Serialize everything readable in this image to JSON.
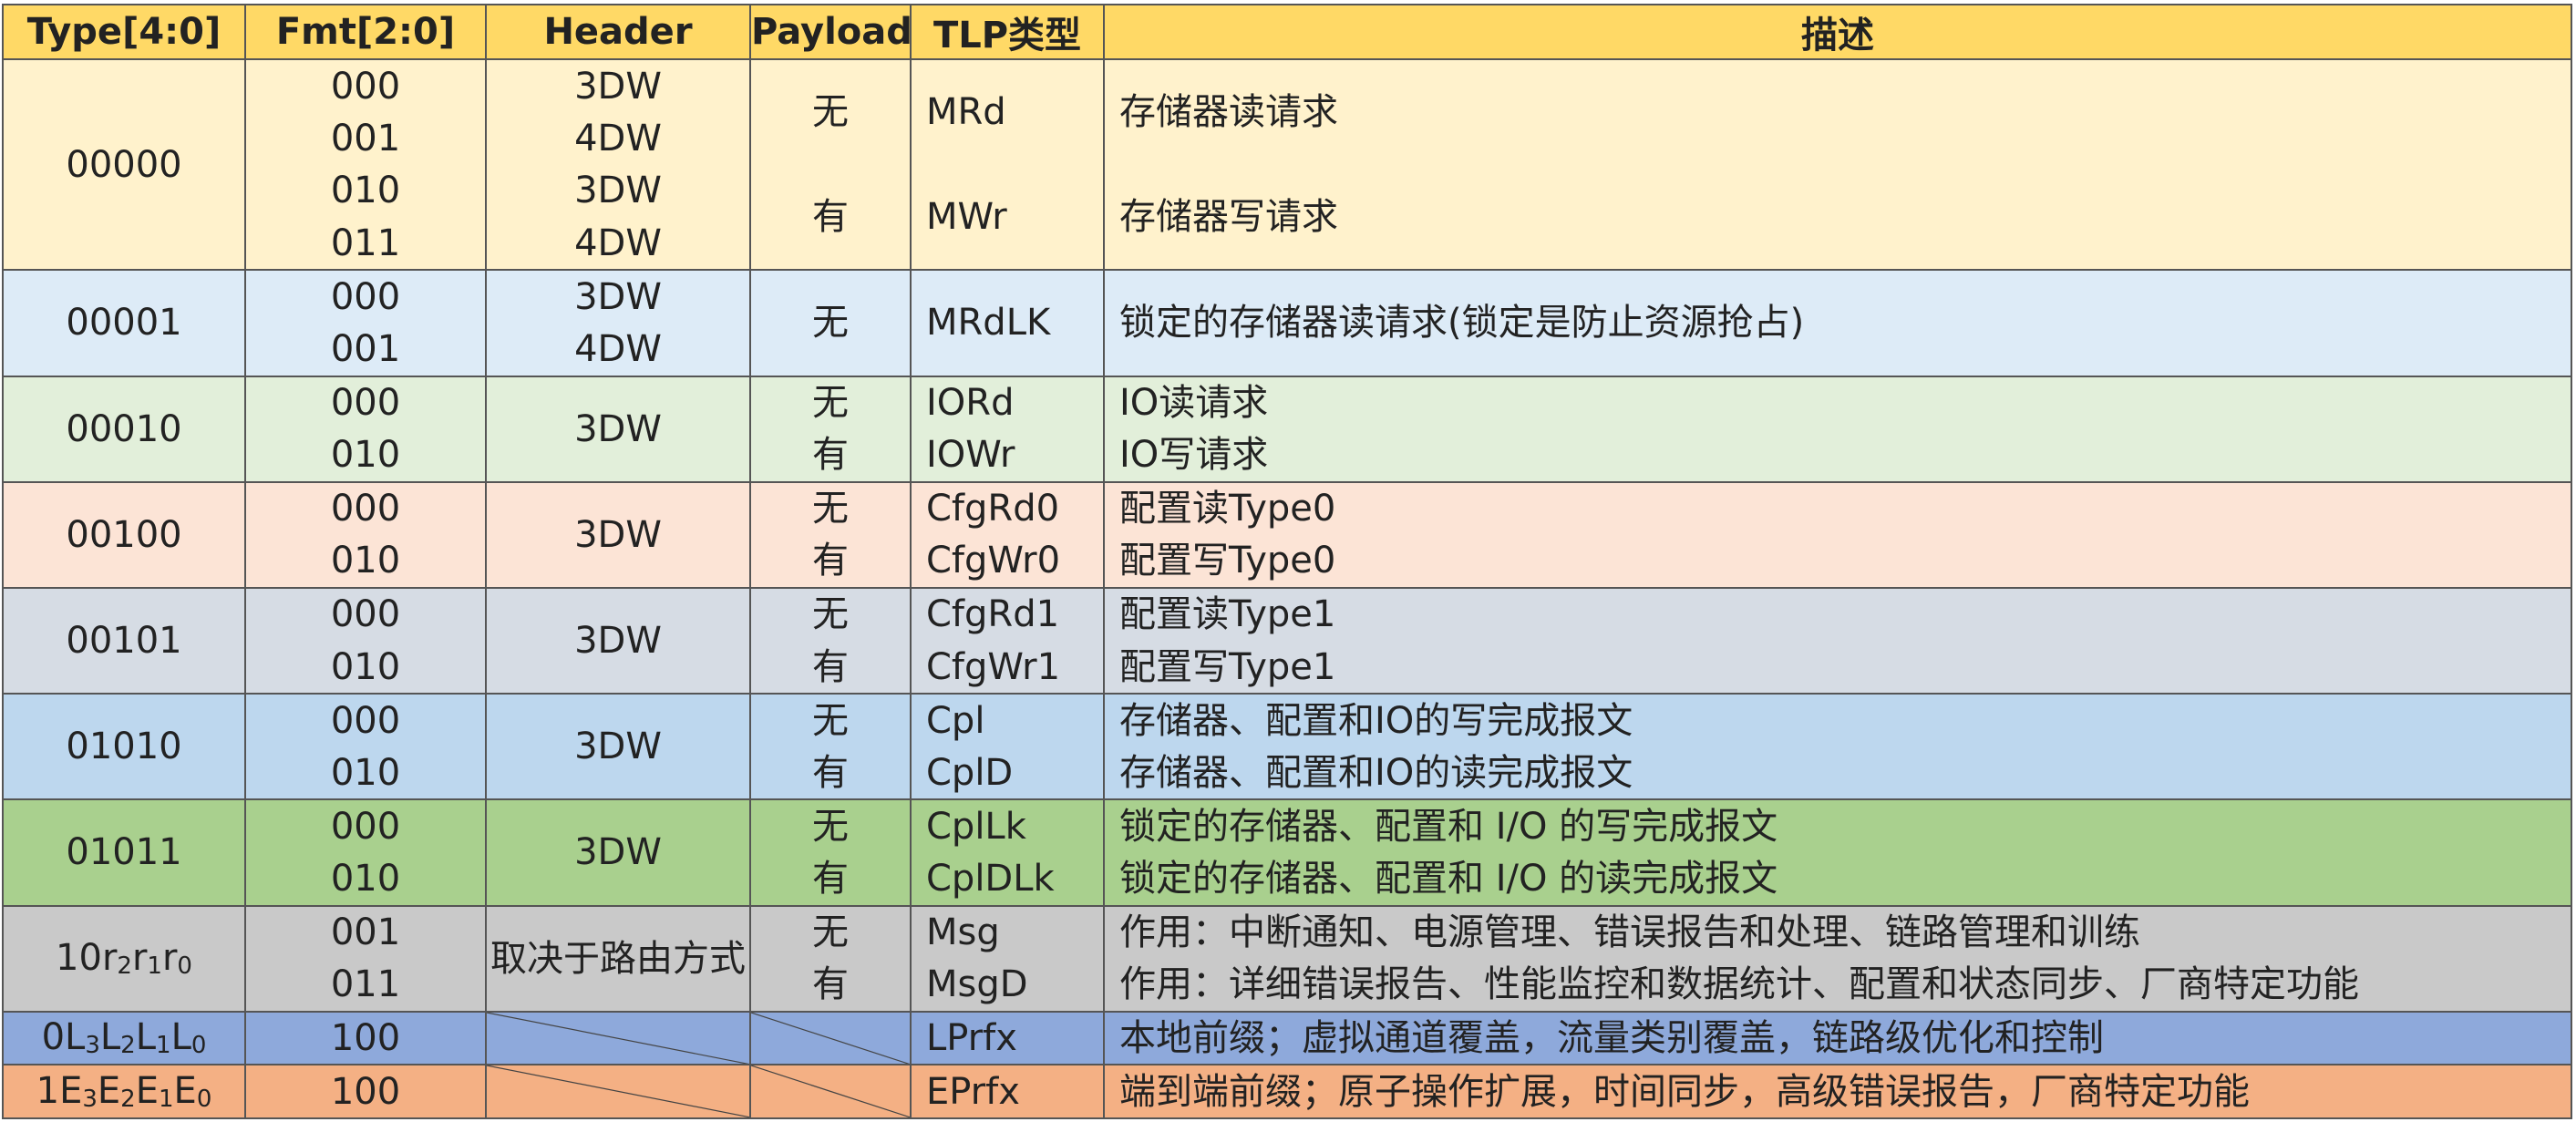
{
  "headers": [
    "Type[4:0]",
    "Fmt[2:0]",
    "Header",
    "Payload",
    "TLP类型",
    "描述"
  ],
  "rows": [
    {
      "type": "00000",
      "fmt": [
        "000",
        "001",
        "010",
        "011"
      ],
      "header": [
        "3DW",
        "4DW",
        "3DW",
        "4DW"
      ],
      "payload": [
        "无",
        "有"
      ],
      "tlp": [
        "MRd",
        "MWr"
      ],
      "desc": [
        "存储器读请求",
        "存储器写请求"
      ],
      "color": "#fff2cc"
    },
    {
      "type": "00001",
      "fmt": [
        "000",
        "001"
      ],
      "header": [
        "3DW",
        "4DW"
      ],
      "payload": [
        "无"
      ],
      "tlp": [
        "MRdLK"
      ],
      "desc": [
        "锁定的存储器读请求(锁定是防止资源抢占)"
      ],
      "color": "#ddebf7"
    },
    {
      "type": "00010",
      "fmt": [
        "000",
        "010"
      ],
      "header": [
        "3DW"
      ],
      "payload": [
        "无",
        "有"
      ],
      "tlp": [
        "IORd",
        "IOWr"
      ],
      "desc": [
        "IO读请求",
        "IO写请求"
      ],
      "color": "#e2efda"
    },
    {
      "type": "00100",
      "fmt": [
        "000",
        "010"
      ],
      "header": [
        "3DW"
      ],
      "payload": [
        "无",
        "有"
      ],
      "tlp": [
        "CfgRd0",
        "CfgWr0"
      ],
      "desc": [
        "配置读Type0",
        "配置写Type0"
      ],
      "color": "#fce4d6"
    },
    {
      "type": "00101",
      "fmt": [
        "000",
        "010"
      ],
      "header": [
        "3DW"
      ],
      "payload": [
        "无",
        "有"
      ],
      "tlp": [
        "CfgRd1",
        "CfgWr1"
      ],
      "desc": [
        "配置读Type1",
        "配置写Type1"
      ],
      "color": "#d6dce4"
    },
    {
      "type": "01010",
      "fmt": [
        "000",
        "010"
      ],
      "header": [
        "3DW"
      ],
      "payload": [
        "无",
        "有"
      ],
      "tlp": [
        "Cpl",
        "CplD"
      ],
      "desc": [
        "存储器、配置和IO的写完成报文",
        "存储器、配置和IO的读完成报文"
      ],
      "color": "#bdd7ee"
    },
    {
      "type": "01011",
      "fmt": [
        "000",
        "010"
      ],
      "header": [
        "3DW"
      ],
      "payload": [
        "无",
        "有"
      ],
      "tlp": [
        "CplLk",
        "CplDLk"
      ],
      "desc": [
        "锁定的存储器、配置和 I/O 的写完成报文",
        "锁定的存储器、配置和 I/O 的读完成报文"
      ],
      "color": "#a9d08e"
    },
    {
      "type_parts": [
        [
          "10",
          ""
        ],
        [
          "r",
          "2"
        ],
        [
          "r",
          "1"
        ],
        [
          "r",
          "0"
        ]
      ],
      "fmt": [
        "001",
        "011"
      ],
      "header": [
        "取决于路由方式"
      ],
      "payload": [
        "无",
        "有"
      ],
      "tlp": [
        "Msg",
        "MsgD"
      ],
      "desc": [
        "作用：中断通知、电源管理、错误报告和处理、链路管理和训练",
        "作用：详细错误报告、性能监控和数据统计、配置和状态同步、厂商特定功能"
      ],
      "color": "#c9c9c9"
    },
    {
      "type_parts": [
        [
          "0",
          ""
        ],
        [
          "L",
          "3"
        ],
        [
          "L",
          "2"
        ],
        [
          "L",
          "1"
        ],
        [
          "L",
          "0"
        ]
      ],
      "fmt": [
        "100"
      ],
      "header": [],
      "payload": [],
      "tlp": [
        "LPrfx"
      ],
      "desc": [
        "本地前缀；虚拟通道覆盖，流量类别覆盖，链路级优化和控制"
      ],
      "color": "#8ea9db"
    },
    {
      "type_parts": [
        [
          "1",
          ""
        ],
        [
          "E",
          "3"
        ],
        [
          "E",
          "2"
        ],
        [
          "E",
          "1"
        ],
        [
          "E",
          "0"
        ]
      ],
      "fmt": [
        "100"
      ],
      "header": [],
      "payload": [],
      "tlp": [
        "EPrfx"
      ],
      "desc": [
        "端到端前缀；原子操作扩展，时间同步，高级错误报告，厂商特定功能"
      ],
      "color": "#f4b084"
    }
  ]
}
